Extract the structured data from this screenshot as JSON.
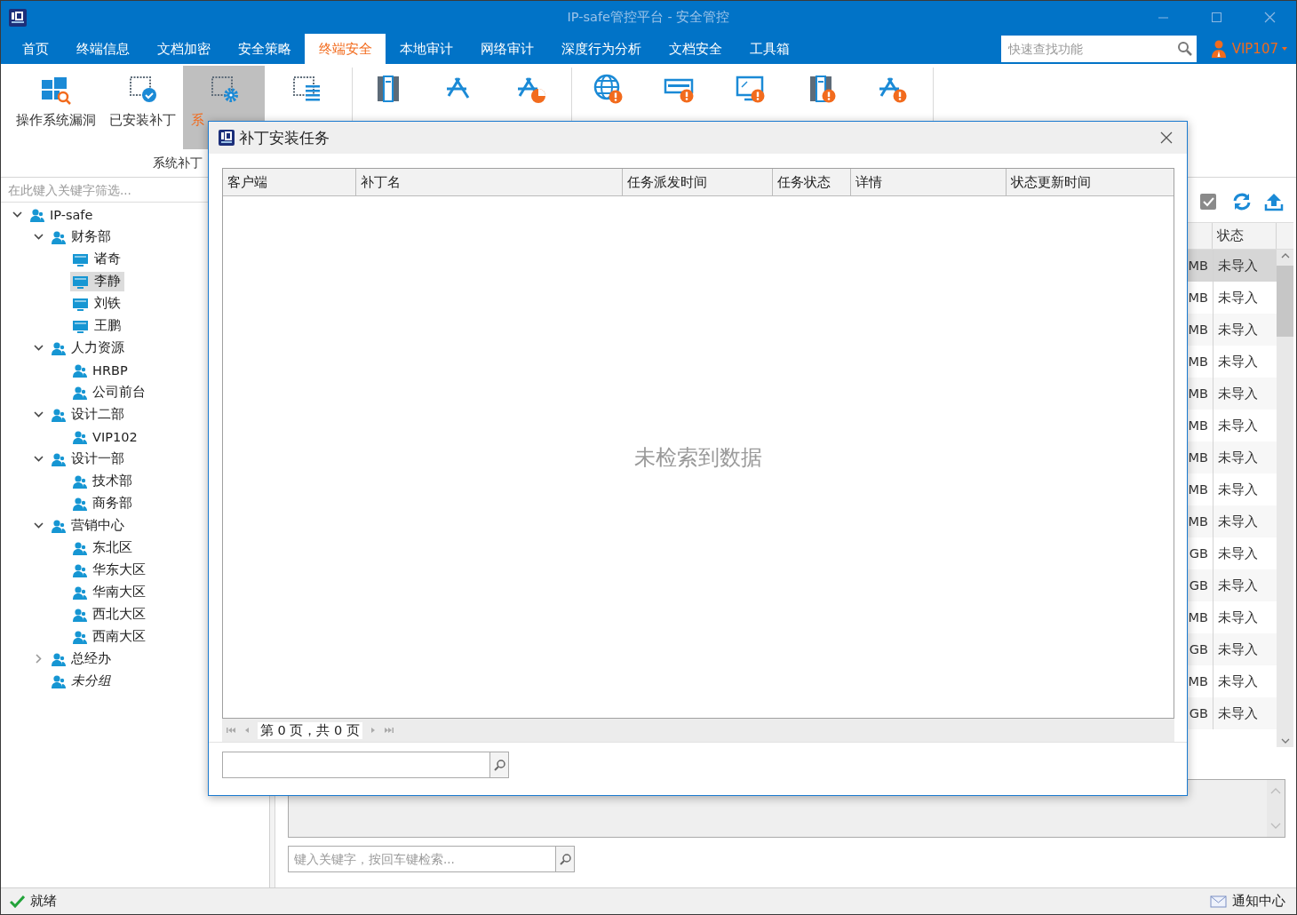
{
  "window": {
    "title": "IP-safe管控平台 - 安全管控"
  },
  "menu_tabs": [
    {
      "label": "首页",
      "selected": false
    },
    {
      "label": "终端信息",
      "selected": false
    },
    {
      "label": "文档加密",
      "selected": false
    },
    {
      "label": "安全策略",
      "selected": false
    },
    {
      "label": "终端安全",
      "selected": true
    },
    {
      "label": "本地审计",
      "selected": false
    },
    {
      "label": "网络审计",
      "selected": false
    },
    {
      "label": "深度行为分析",
      "selected": false
    },
    {
      "label": "文档安全",
      "selected": false
    },
    {
      "label": "工具箱",
      "selected": false
    }
  ],
  "quick_search": {
    "placeholder": "快速查找功能"
  },
  "user": {
    "name": "VIP107"
  },
  "ribbon": {
    "groups": [
      {
        "label": "系统补丁",
        "items": [
          {
            "label": "操作系统漏洞",
            "selected": false
          },
          {
            "label": "已安装补丁",
            "selected": false
          },
          {
            "label": "系",
            "selected": true
          },
          {
            "selected": false
          }
        ]
      },
      {
        "items": [
          {
            "selected": false
          },
          {
            "selected": false
          },
          {
            "selected": false
          }
        ]
      },
      {
        "items": [
          {
            "selected": false
          },
          {
            "selected": false
          },
          {
            "selected": false
          },
          {
            "selected": false
          },
          {
            "selected": false
          }
        ]
      }
    ]
  },
  "tree": {
    "filter_placeholder": "在此键入关键字筛选...",
    "items": [
      {
        "label": "IP-safe",
        "kind": "group",
        "expanded": true,
        "selected": false,
        "children": [
          {
            "label": "财务部",
            "kind": "group",
            "expanded": true,
            "selected": false,
            "children": [
              {
                "label": "诸奇",
                "kind": "computer",
                "selected": false
              },
              {
                "label": "李静",
                "kind": "computer",
                "selected": true
              },
              {
                "label": "刘铁",
                "kind": "computer",
                "selected": false
              },
              {
                "label": "王鹏",
                "kind": "computer",
                "selected": false
              }
            ]
          },
          {
            "label": "人力资源",
            "kind": "group",
            "expanded": true,
            "selected": false,
            "children": [
              {
                "label": "HRBP",
                "kind": "group",
                "selected": false
              },
              {
                "label": "公司前台",
                "kind": "group",
                "selected": false
              }
            ]
          },
          {
            "label": "设计二部",
            "kind": "group",
            "expanded": true,
            "selected": false,
            "children": [
              {
                "label": "VIP102",
                "kind": "group",
                "selected": false
              }
            ]
          },
          {
            "label": "设计一部",
            "kind": "group",
            "expanded": true,
            "selected": false,
            "children": [
              {
                "label": "技术部",
                "kind": "group",
                "selected": false
              },
              {
                "label": "商务部",
                "kind": "group",
                "selected": false
              }
            ]
          },
          {
            "label": "营销中心",
            "kind": "group",
            "expanded": true,
            "selected": false,
            "children": [
              {
                "label": "东北区",
                "kind": "group",
                "selected": false
              },
              {
                "label": "华东大区",
                "kind": "group",
                "selected": false
              },
              {
                "label": "华南大区",
                "kind": "group",
                "selected": false
              },
              {
                "label": "西北大区",
                "kind": "group",
                "selected": false
              },
              {
                "label": "西南大区",
                "kind": "group",
                "selected": false
              }
            ]
          },
          {
            "label": "总经办",
            "kind": "group",
            "expanded": false,
            "selected": false
          },
          {
            "label": "未分组",
            "kind": "ungrouped",
            "selected": false
          }
        ]
      }
    ]
  },
  "records": {
    "columns": [
      "状态"
    ],
    "rows": [
      {
        "column_1": "MB",
        "status": "未导入",
        "selected": true
      },
      {
        "column_1": "MB",
        "status": "未导入",
        "selected": false
      },
      {
        "column_1": "MB",
        "status": "未导入",
        "selected": false
      },
      {
        "column_1": "MB",
        "status": "未导入",
        "selected": false
      },
      {
        "column_1": "MB",
        "status": "未导入",
        "selected": false
      },
      {
        "column_1": "MB",
        "status": "未导入",
        "selected": false
      },
      {
        "column_1": "MB",
        "status": "未导入",
        "selected": false
      },
      {
        "column_1": "MB",
        "status": "未导入",
        "selected": false
      },
      {
        "column_1": "MB",
        "status": "未导入",
        "selected": false
      },
      {
        "column_1": "GB",
        "status": "未导入",
        "selected": false
      },
      {
        "column_1": "GB",
        "status": "未导入",
        "selected": false
      },
      {
        "column_1": "MB",
        "status": "未导入",
        "selected": false
      },
      {
        "column_1": "GB",
        "status": "未导入",
        "selected": false
      },
      {
        "column_1": "MB",
        "status": "未导入",
        "selected": false
      },
      {
        "column_1": "GB",
        "status": "未导入",
        "selected": false
      }
    ]
  },
  "main_search": {
    "placeholder": "键入关键字，按回车键检索..."
  },
  "status_bar": {
    "status": "就绪",
    "notifications": "通知中心"
  },
  "dialog": {
    "title": "补丁安装任务",
    "columns": [
      "客户端",
      "补丁名",
      "任务派发时间",
      "任务状态",
      "详情",
      "状态更新时间"
    ],
    "empty_message": "未检索到数据",
    "pager": "第 0 页，共 0 页"
  }
}
